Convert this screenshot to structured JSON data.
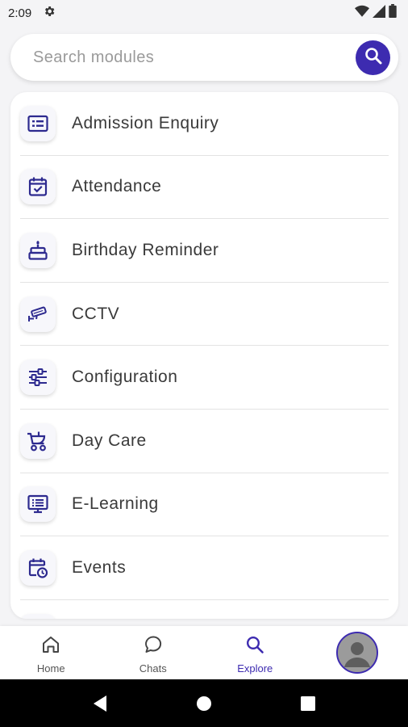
{
  "status_bar": {
    "time": "2:09",
    "icons": [
      "settings-icon",
      "wifi-icon",
      "signal-icon",
      "battery-icon"
    ]
  },
  "search": {
    "placeholder": "Search modules",
    "button_icon": "search-icon"
  },
  "modules": [
    {
      "label": "Admission Enquiry",
      "icon": "form-list-icon"
    },
    {
      "label": "Attendance",
      "icon": "calendar-check-icon"
    },
    {
      "label": "Birthday Reminder",
      "icon": "cake-icon"
    },
    {
      "label": "CCTV",
      "icon": "cctv-camera-icon"
    },
    {
      "label": "Configuration",
      "icon": "sliders-icon"
    },
    {
      "label": "Day Care",
      "icon": "stroller-icon"
    },
    {
      "label": "E-Learning",
      "icon": "monitor-icon"
    },
    {
      "label": "Events",
      "icon": "calendar-clock-icon"
    }
  ],
  "bottom_nav": {
    "items": [
      {
        "label": "Home",
        "icon": "home-icon",
        "active": false
      },
      {
        "label": "Chats",
        "icon": "chat-bubble-icon",
        "active": false
      },
      {
        "label": "Explore",
        "icon": "search-icon",
        "active": true
      }
    ],
    "avatar_icon": "user-avatar-icon"
  },
  "colors": {
    "accent": "#3d2bb0",
    "icon": "#2d2a8f",
    "background": "#f4f4f6"
  }
}
